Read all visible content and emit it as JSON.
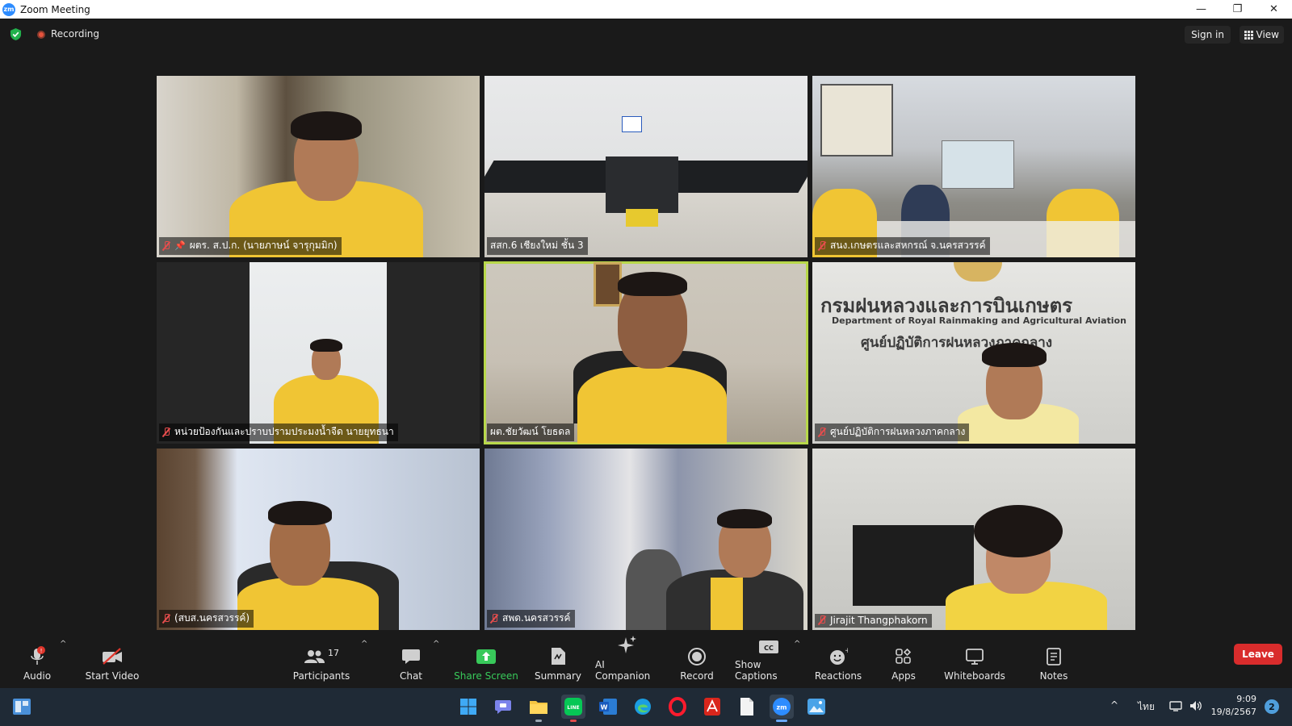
{
  "window": {
    "title": "Zoom Meeting",
    "logo": "zm"
  },
  "topbar": {
    "recording_label": "Recording",
    "sign_in_label": "Sign in",
    "view_label": "View"
  },
  "participants": [
    {
      "name": "ผตร. ส.ป.ก. (นายภาษน์ จารุกุมมิก)",
      "muted": true,
      "pinned": true
    },
    {
      "name": "สสก.6 เชียงใหม่ ชั้น 3",
      "muted": false
    },
    {
      "name": "สนง.เกษตรและสหกรณ์ จ.นครสวรรค์",
      "muted": true
    },
    {
      "name": "หน่วยป้องกันและปราบปรามประมงน้ำจืด นายยุทธนา",
      "muted": true
    },
    {
      "name": "ผต.ชัยวัฒน์ โยธดล",
      "muted": false,
      "active": true
    },
    {
      "name": "ศูนย์ปฏิบัติการฝนหลวงภาคกลาง",
      "muted": true
    },
    {
      "name": "(สบส.นครสวรรค์)",
      "muted": true
    },
    {
      "name": "สพด.นครสวรรค์",
      "muted": true
    },
    {
      "name": "Jirajit Thangphakorn",
      "muted": true
    }
  ],
  "signage": {
    "thai": "กรมฝนหลวงและการบินเกษตร",
    "english": "Department of Royal Rainmaking and Agricultural Aviation",
    "center": "ศูนย์ปฏิบัติการฝนหลวงภาคกลาง"
  },
  "toolbar": {
    "audio": "Audio",
    "start_video": "Start Video",
    "participants": "Participants",
    "participants_count": "17",
    "chat": "Chat",
    "share_screen": "Share Screen",
    "summary": "Summary",
    "ai_companion": "AI Companion",
    "record": "Record",
    "show_captions": "Show Captions",
    "reactions": "Reactions",
    "apps": "Apps",
    "whiteboards": "Whiteboards",
    "notes": "Notes",
    "leave": "Leave"
  },
  "taskbar": {
    "language": "ไทย",
    "time": "9:09",
    "date": "19/8/2567",
    "notification_count": "2"
  },
  "colors": {
    "accent_green": "#38c95a",
    "leave_red": "#d92c2c",
    "active_outline": "#b8d84a",
    "zoom_blue": "#2d8cff"
  }
}
